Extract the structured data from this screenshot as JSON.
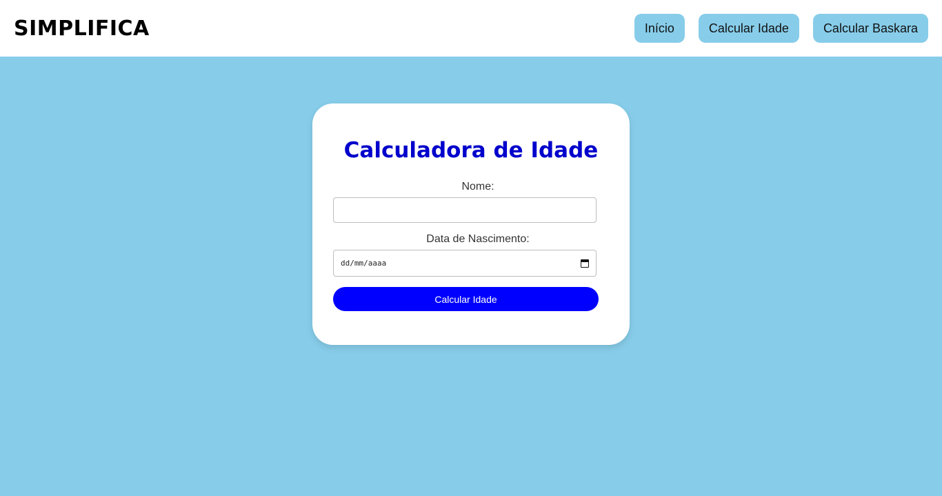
{
  "header": {
    "logo": "SIMPLIFICA",
    "nav": [
      {
        "label": "Início"
      },
      {
        "label": "Calcular Idade"
      },
      {
        "label": "Calcular Baskara"
      }
    ]
  },
  "form": {
    "title": "Calculadora de Idade",
    "name_label": "Nome:",
    "name_value": "",
    "date_label": "Data de Nascimento:",
    "date_placeholder": "dd/mm/aaaa",
    "submit_label": "Calcular Idade"
  },
  "colors": {
    "background": "#87cdea",
    "title": "#0000cc",
    "button": "#0000ff",
    "nav_button": "#87cdea"
  }
}
